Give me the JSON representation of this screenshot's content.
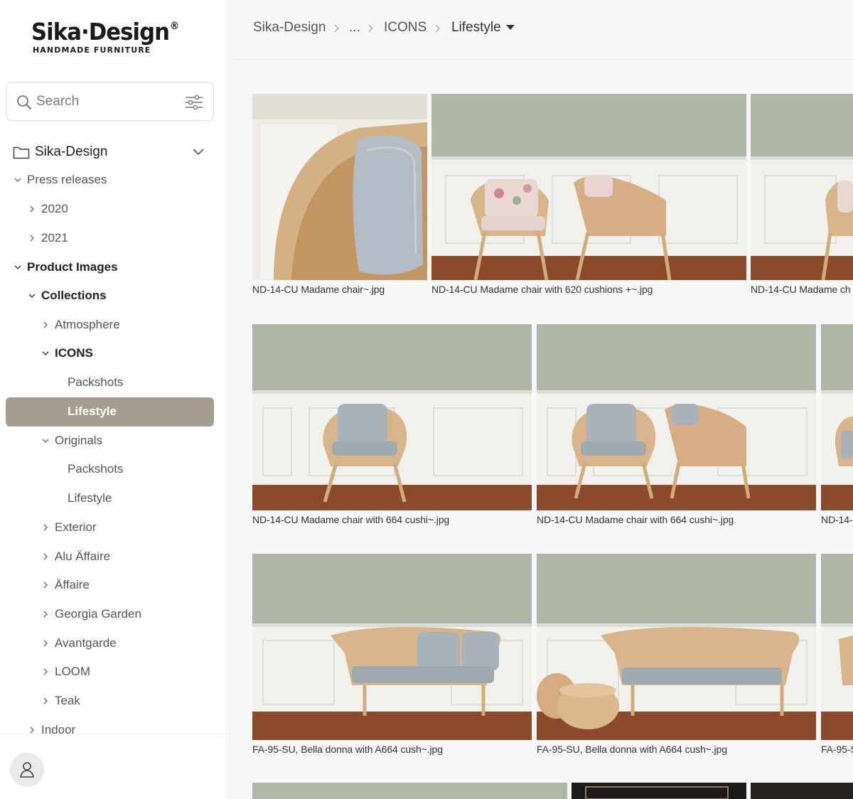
{
  "brand": {
    "name": "Sika·Design",
    "registered": "®",
    "tagline": "HANDMADE FURNITURE"
  },
  "search": {
    "placeholder": "Search"
  },
  "tree": {
    "root": "Sika-Design",
    "nodes": [
      {
        "label": "Press releases",
        "state": "expanded"
      },
      {
        "label": "2020",
        "state": "collapsed"
      },
      {
        "label": "2021",
        "state": "collapsed"
      },
      {
        "label": "Product Images",
        "state": "expanded"
      },
      {
        "label": "Collections",
        "state": "expanded"
      },
      {
        "label": "Atmosphere",
        "state": "collapsed"
      },
      {
        "label": "ICONS",
        "state": "expanded"
      },
      {
        "label": "Packshots",
        "state": "leaf"
      },
      {
        "label": "Lifestyle",
        "state": "selected"
      },
      {
        "label": "Originals",
        "state": "expanded"
      },
      {
        "label": "Packshots",
        "state": "leaf"
      },
      {
        "label": "Lifestyle",
        "state": "leaf"
      },
      {
        "label": "Exterior",
        "state": "collapsed"
      },
      {
        "label": "Alu Äffaire",
        "state": "collapsed"
      },
      {
        "label": "Äffaire",
        "state": "collapsed"
      },
      {
        "label": "Georgia Garden",
        "state": "collapsed"
      },
      {
        "label": "Avantgarde",
        "state": "collapsed"
      },
      {
        "label": "LOOM",
        "state": "collapsed"
      },
      {
        "label": "Teak",
        "state": "collapsed"
      },
      {
        "label": "Indoor",
        "state": "collapsed"
      }
    ]
  },
  "breadcrumb": {
    "items": [
      "Sika-Design",
      "...",
      "ICONS",
      "Lifestyle"
    ]
  },
  "gallery": {
    "captions": [
      "ND-14-CU Madame chair~.jpg",
      "ND-14-CU Madame chair with 620 cushions +~.jpg",
      "ND-14-CU Madame ch",
      "ND-14-CU Madame chair with 664 cushi~.jpg",
      "ND-14-CU Madame chair with 664 cushi~.jpg",
      "ND-14-",
      "FA-95-SU, Bella donna with A664 cush~.jpg",
      "FA-95-SU, Bella donna with A664 cush~.jpg",
      "FA-95-S"
    ]
  },
  "colors": {
    "selected_bg": "#a49d90",
    "wall": "#aeb6a6",
    "wainscot": "#f1f0ec",
    "floor": "#8b4a2a",
    "rattan": "#d8b48a",
    "cushion": "#a9b2b8"
  }
}
